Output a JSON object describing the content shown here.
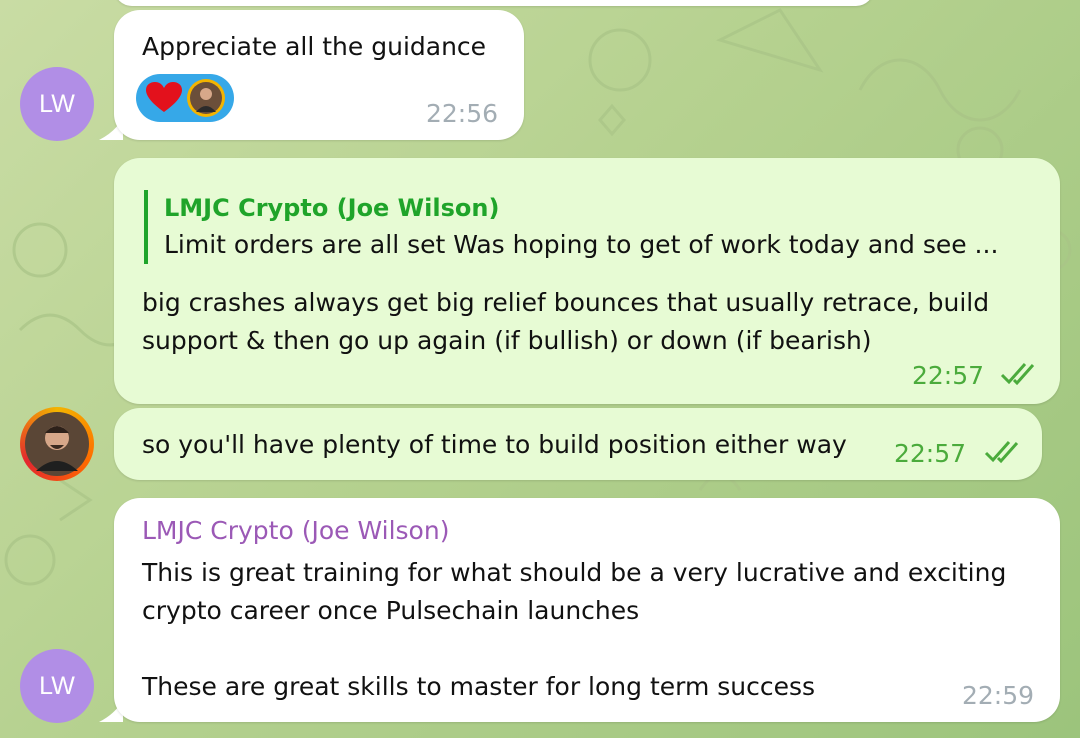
{
  "messages": [
    {
      "id": "m1",
      "type": "incoming",
      "text": "Appreciate all the guidance",
      "time": "22:56",
      "avatar_initials": "LW",
      "reaction": {
        "emoji": "heart-icon",
        "reactor": "user-avatar"
      }
    },
    {
      "id": "m2",
      "type": "outgoing",
      "reply_to": {
        "sender": "LMJC Crypto (Joe Wilson)",
        "text": "Limit orders are all set  Was hoping to get of work today and see ..."
      },
      "text": "big crashes always get big relief bounces that usually retrace, build support & then go up again (if bullish) or down (if bearish)",
      "time": "22:57",
      "status": "read"
    },
    {
      "id": "m3",
      "type": "outgoing",
      "text": "so you'll have plenty of time to build position either way",
      "time": "22:57",
      "status": "read"
    },
    {
      "id": "m4",
      "type": "incoming",
      "sender": "LMJC Crypto (Joe Wilson)",
      "text": "This is great training for what should be a very lucrative and exciting crypto career once Pulsechain launches\n\nThese are great skills to master for long term success",
      "time": "22:59",
      "avatar_initials": "LW"
    }
  ],
  "colors": {
    "incoming_bubble": "#ffffff",
    "outgoing_bubble": "#e7fbd4",
    "outgoing_time": "#4bab3c",
    "incoming_time": "#a3adb4",
    "sender_name": "#9b59b6",
    "reply_accent": "#1fa42a",
    "avatar_lw": "#b18ee6"
  }
}
